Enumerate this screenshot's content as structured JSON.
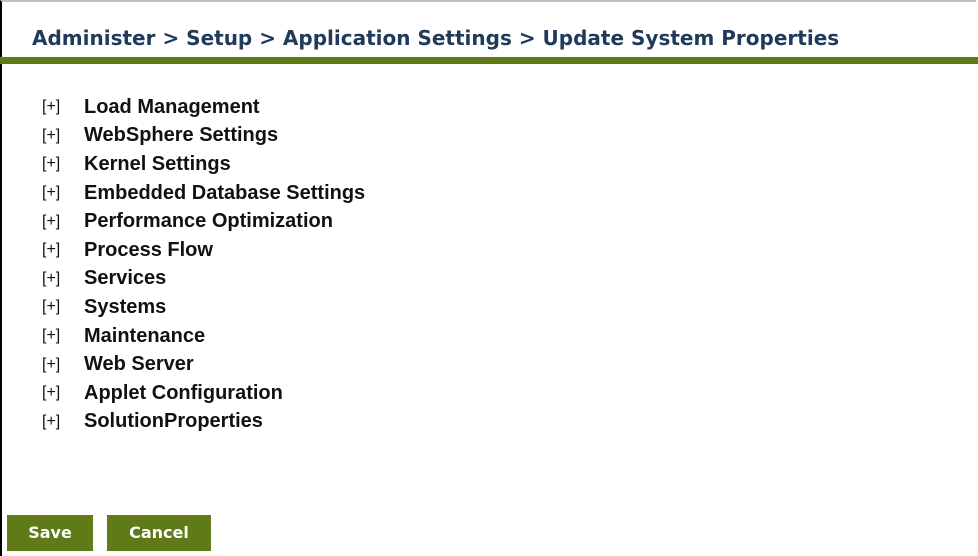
{
  "breadcrumb": "Administer > Setup > Application Settings > Update System Properties",
  "colors": {
    "accent": "#5f7a17",
    "breadcrumb_text": "#1f3a5a"
  },
  "tree": {
    "items": [
      {
        "toggle": "[+]",
        "label": "Load Management"
      },
      {
        "toggle": "[+]",
        "label": "WebSphere Settings"
      },
      {
        "toggle": "[+]",
        "label": "Kernel Settings"
      },
      {
        "toggle": "[+]",
        "label": "Embedded Database Settings"
      },
      {
        "toggle": "[+]",
        "label": "Performance Optimization"
      },
      {
        "toggle": "[+]",
        "label": "Process Flow"
      },
      {
        "toggle": "[+]",
        "label": "Services"
      },
      {
        "toggle": "[+]",
        "label": "Systems"
      },
      {
        "toggle": "[+]",
        "label": "Maintenance"
      },
      {
        "toggle": "[+]",
        "label": "Web Server"
      },
      {
        "toggle": "[+]",
        "label": "Applet Configuration"
      },
      {
        "toggle": "[+]",
        "label": "SolutionProperties"
      }
    ]
  },
  "buttons": {
    "save_label": "Save",
    "cancel_label": "Cancel"
  }
}
